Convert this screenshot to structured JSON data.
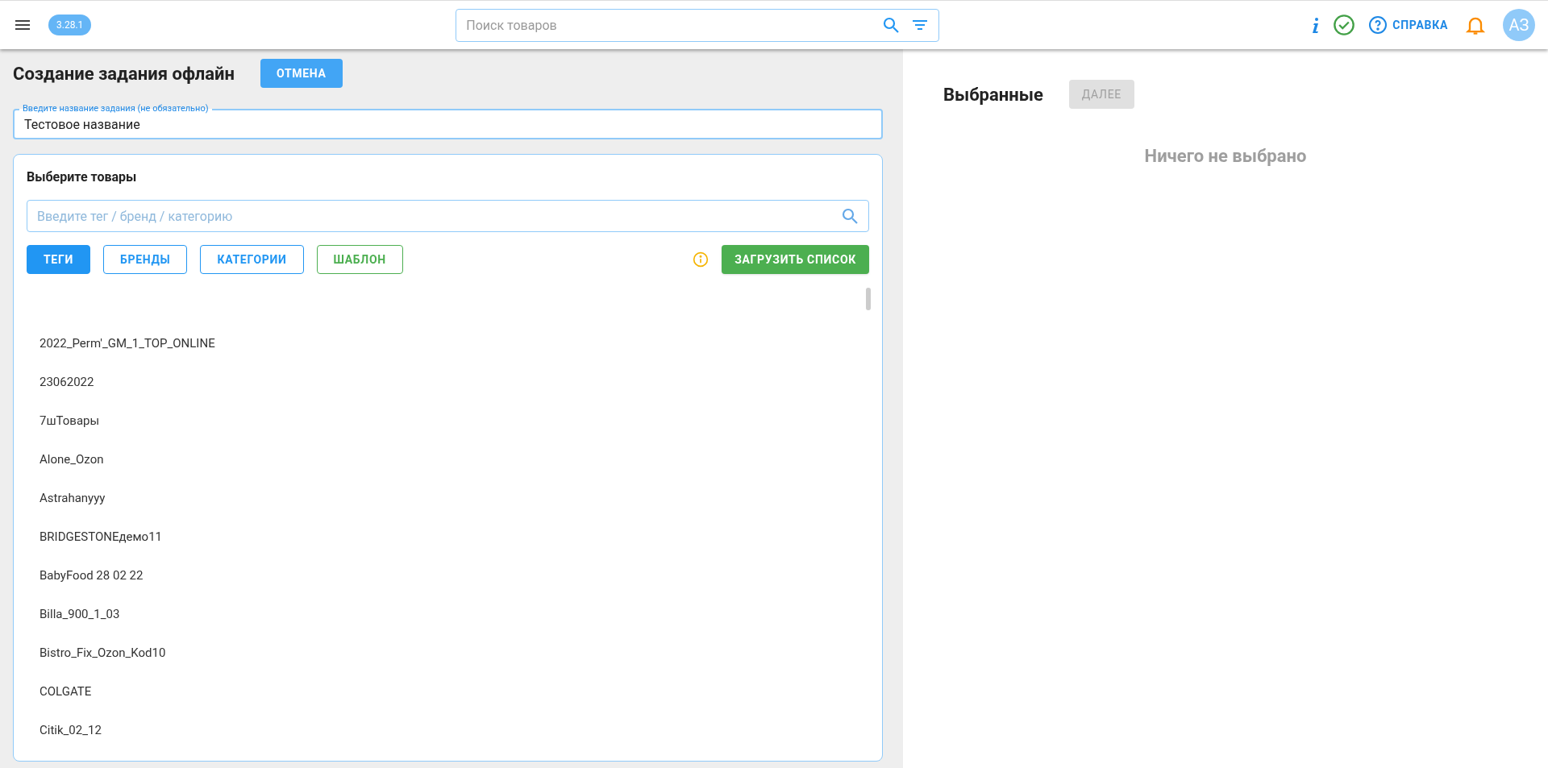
{
  "header": {
    "version": "3.28.1",
    "search_placeholder": "Поиск товаров",
    "help_label": "СПРАВКА",
    "avatar": "АЗ"
  },
  "left": {
    "title": "Создание задания офлайн",
    "cancel_button": "ОТМЕНА",
    "name_field": {
      "label": "Введите название задания (не обязательно)",
      "value": "Тестовое название"
    },
    "products": {
      "title": "Выберите товары",
      "search_placeholder": "Введите тег / бренд / категорию",
      "filters": [
        {
          "label": "ТЕГИ",
          "selected": true
        },
        {
          "label": "БРЕНДЫ",
          "selected": false
        },
        {
          "label": "КАТЕГОРИИ",
          "selected": false
        }
      ],
      "template_button": "ШАБЛОН",
      "upload_button": "ЗАГРУЗИТЬ СПИСОК",
      "items": [
        "2022_Perm'_GM_1_TOP_ONLINE",
        "23062022",
        "7шТовары",
        "Alone_Ozon",
        "Astrahanyyy",
        "BRIDGESTONEдемо11",
        "BabyFood 28 02 22",
        "Billa_900_1_03",
        "Bistro_Fix_Ozon_Kod10",
        "COLGATE",
        "Citik_02_12"
      ]
    }
  },
  "right": {
    "title": "Выбранные",
    "next_button": {
      "label": "ДАЛЕЕ",
      "disabled": true
    },
    "empty_text": "Ничего не выбрано"
  }
}
